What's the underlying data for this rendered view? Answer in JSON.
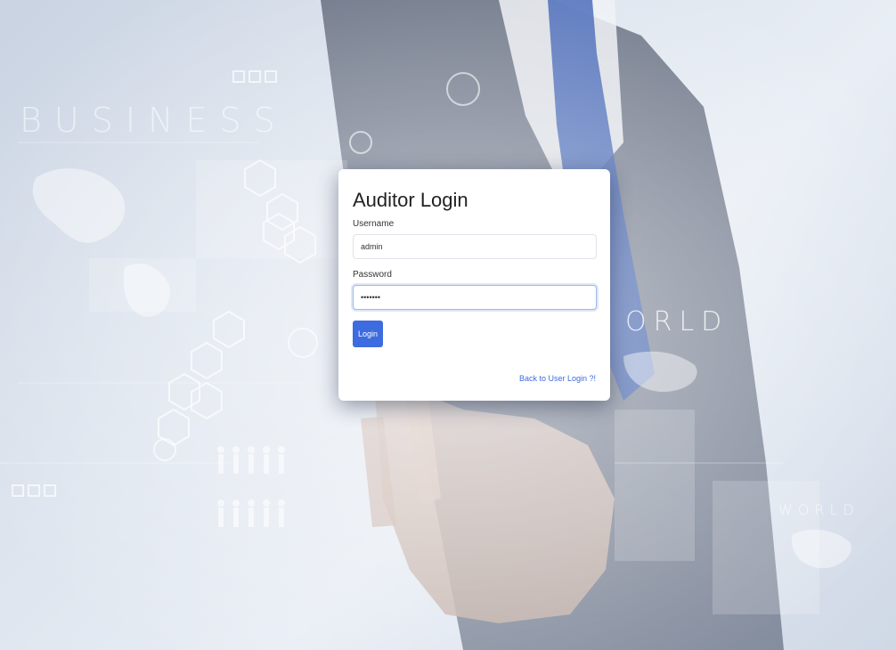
{
  "background": {
    "business_text": "BUSINESS",
    "world_text": "ORLD",
    "world_small_text": "WORLD",
    "accent_color": "#3d6be0"
  },
  "login": {
    "title": "Auditor Login",
    "username_label": "Username",
    "username_value": "admin",
    "password_label": "Password",
    "password_value": "admin12",
    "login_button": "Login",
    "back_link": "Back to User Login ?!"
  }
}
